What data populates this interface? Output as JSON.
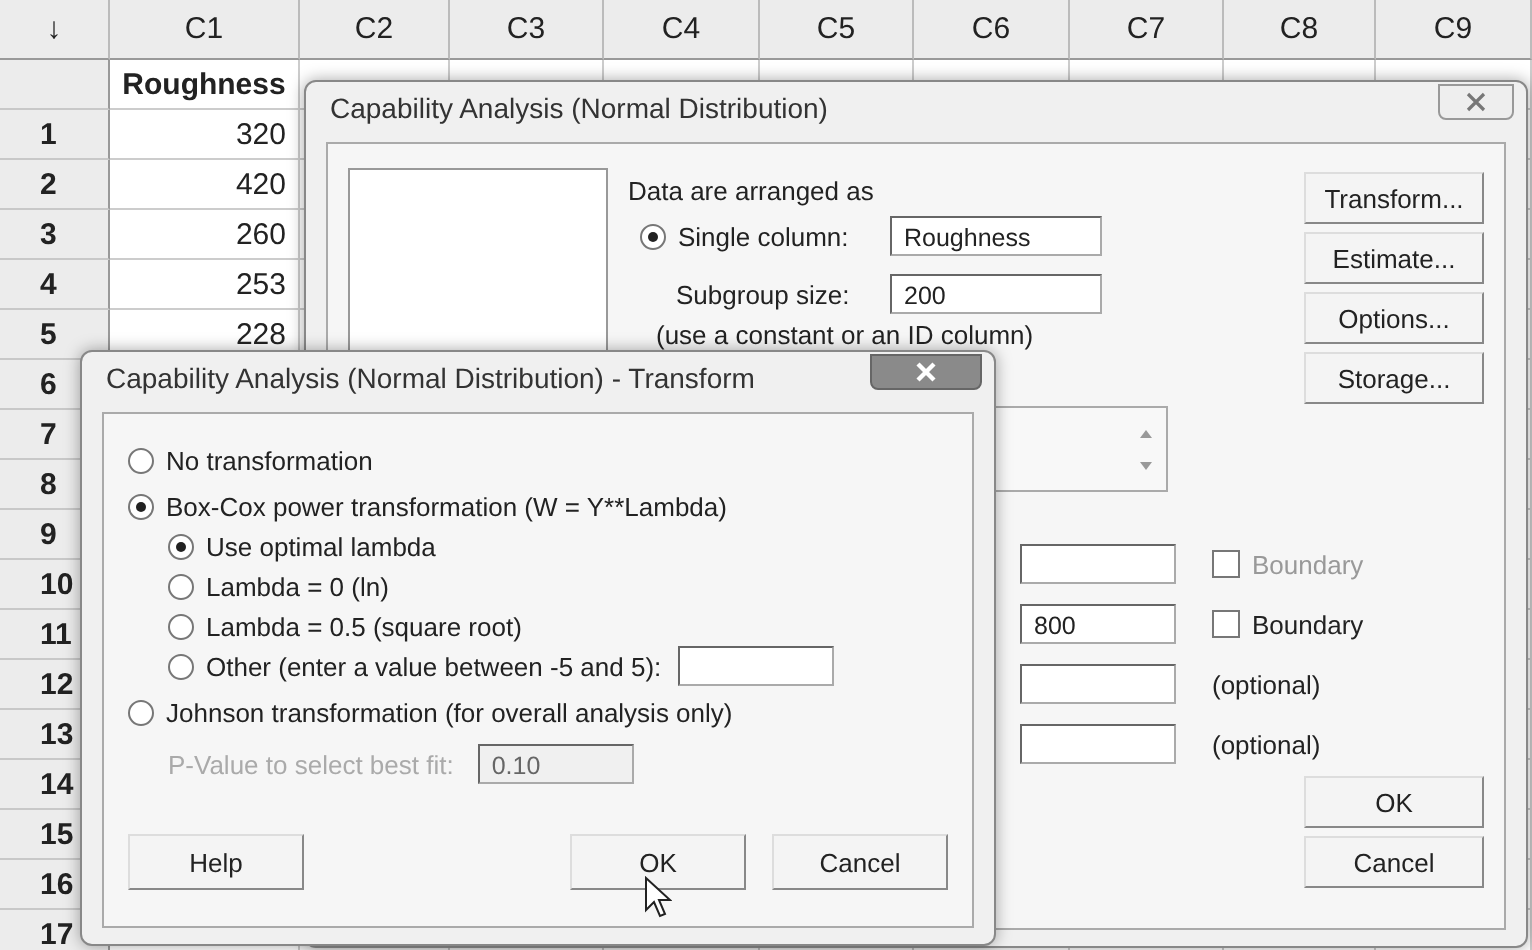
{
  "worksheet": {
    "corner": "↓",
    "columns": [
      "C1",
      "C2",
      "C3",
      "C4",
      "C5",
      "C6",
      "C7",
      "C8",
      "C9"
    ],
    "column_names": [
      "Roughness"
    ],
    "row_numbers": [
      "1",
      "2",
      "3",
      "4",
      "5",
      "6",
      "7",
      "8",
      "9",
      "10",
      "11",
      "12",
      "13",
      "14",
      "15",
      "16",
      "17"
    ],
    "rows": [
      [
        "320"
      ],
      [
        "420"
      ],
      [
        "260"
      ],
      [
        "253"
      ],
      [
        "228"
      ]
    ]
  },
  "main_dialog": {
    "title": "Capability Analysis (Normal Distribution)",
    "data_label": "Data are arranged as",
    "options": [
      {
        "label": "Single column:",
        "selected": true,
        "value": "Roughness"
      }
    ],
    "subgroup_label": "Subgroup size:",
    "subgroup_value": "200",
    "hint": "(use a constant or an ID column)",
    "side_buttons": [
      "Transform...",
      "Estimate...",
      "Options...",
      "Storage..."
    ],
    "limits": [
      {
        "kind": "checkbox",
        "label": "Boundary",
        "checked": false,
        "disabled": true
      },
      {
        "kind": "checkbox",
        "value": "800",
        "label": "Boundary",
        "checked": false,
        "disabled": false
      },
      {
        "kind": "note",
        "label": "(optional)"
      },
      {
        "kind": "note",
        "label": "(optional)"
      }
    ],
    "buttons": [
      "OK",
      "Cancel"
    ]
  },
  "transform_dialog": {
    "title": "Capability Analysis (Normal Distribution) - Transform",
    "options": [
      {
        "label": "No transformation",
        "selected": false
      },
      {
        "label": "Box-Cox power transformation (W = Y**Lambda)",
        "selected": true,
        "children": [
          {
            "label": "Use optimal lambda",
            "selected": true
          },
          {
            "label": "Lambda = 0 (ln)",
            "selected": false
          },
          {
            "label": "Lambda = 0.5 (square root)",
            "selected": false
          },
          {
            "label": "Other (enter a value between -5 and 5):",
            "selected": false,
            "kind": "with_field"
          }
        ]
      },
      {
        "label": "Johnson transformation (for overall analysis only)",
        "selected": false,
        "detail": {
          "label": "P-Value to select best fit:",
          "value": "0.10",
          "disabled": true
        }
      }
    ],
    "buttons": [
      "Help",
      "OK",
      "Cancel"
    ]
  }
}
